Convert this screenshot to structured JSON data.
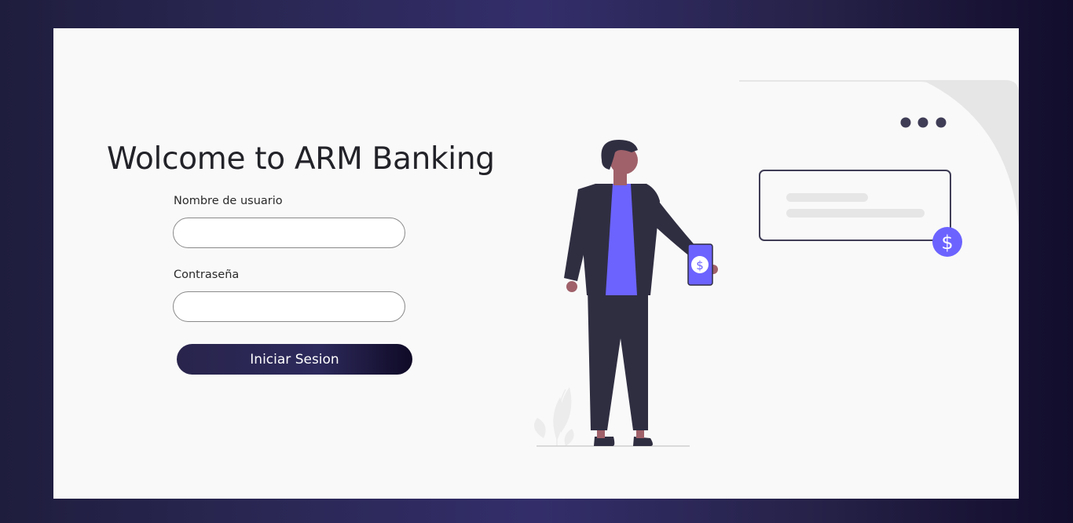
{
  "login": {
    "title": "Wolcome to ARM Banking",
    "username_label": "Nombre de usuario",
    "username_value": "",
    "password_label": "Contraseña",
    "password_value": "",
    "submit_label": "Iniciar Sesion"
  },
  "illustration": {
    "coin_symbol": "$",
    "colors": {
      "accent": "#6c63ff",
      "dark": "#2f2e41",
      "skin": "#a0616a",
      "panel": "#e6e6e6"
    }
  }
}
